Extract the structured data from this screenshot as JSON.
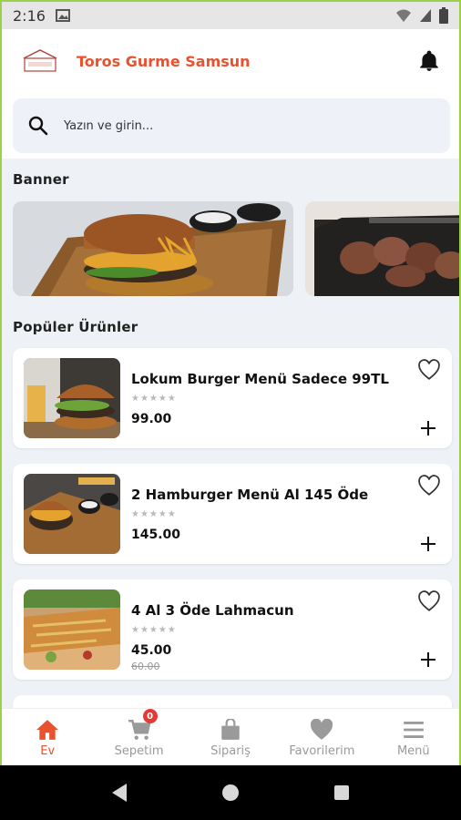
{
  "statusbar": {
    "time": "2:16"
  },
  "header": {
    "brand": "Toros Gurme Samsun"
  },
  "search": {
    "placeholder": "Yazın ve girin..."
  },
  "sections": {
    "banner": "Banner",
    "popular": "Popüler Ürünler"
  },
  "products": [
    {
      "title": "Lokum Burger Menü Sadece 99TL",
      "stars": "★★★★★",
      "price": "99.00"
    },
    {
      "title": "2 Hamburger Menü Al 145 Öde",
      "stars": "★★★★★",
      "price": "145.00"
    },
    {
      "title": "4 Al 3 Öde Lahmacun",
      "stars": "★★★★★",
      "price": "45.00",
      "old_price": "60.00"
    }
  ],
  "bottomnav": {
    "home": "Ev",
    "cart": "Sepetim",
    "cart_badge": "0",
    "orders": "Sipariş",
    "favorites": "Favorilerim",
    "menu": "Menü"
  },
  "colors": {
    "accent": "#e8522e",
    "badge": "#e53935"
  },
  "icons": [
    "search-icon",
    "bell-icon",
    "heart-icon",
    "plus-icon",
    "home-icon",
    "cart-icon",
    "bag-icon",
    "menu-icon"
  ]
}
